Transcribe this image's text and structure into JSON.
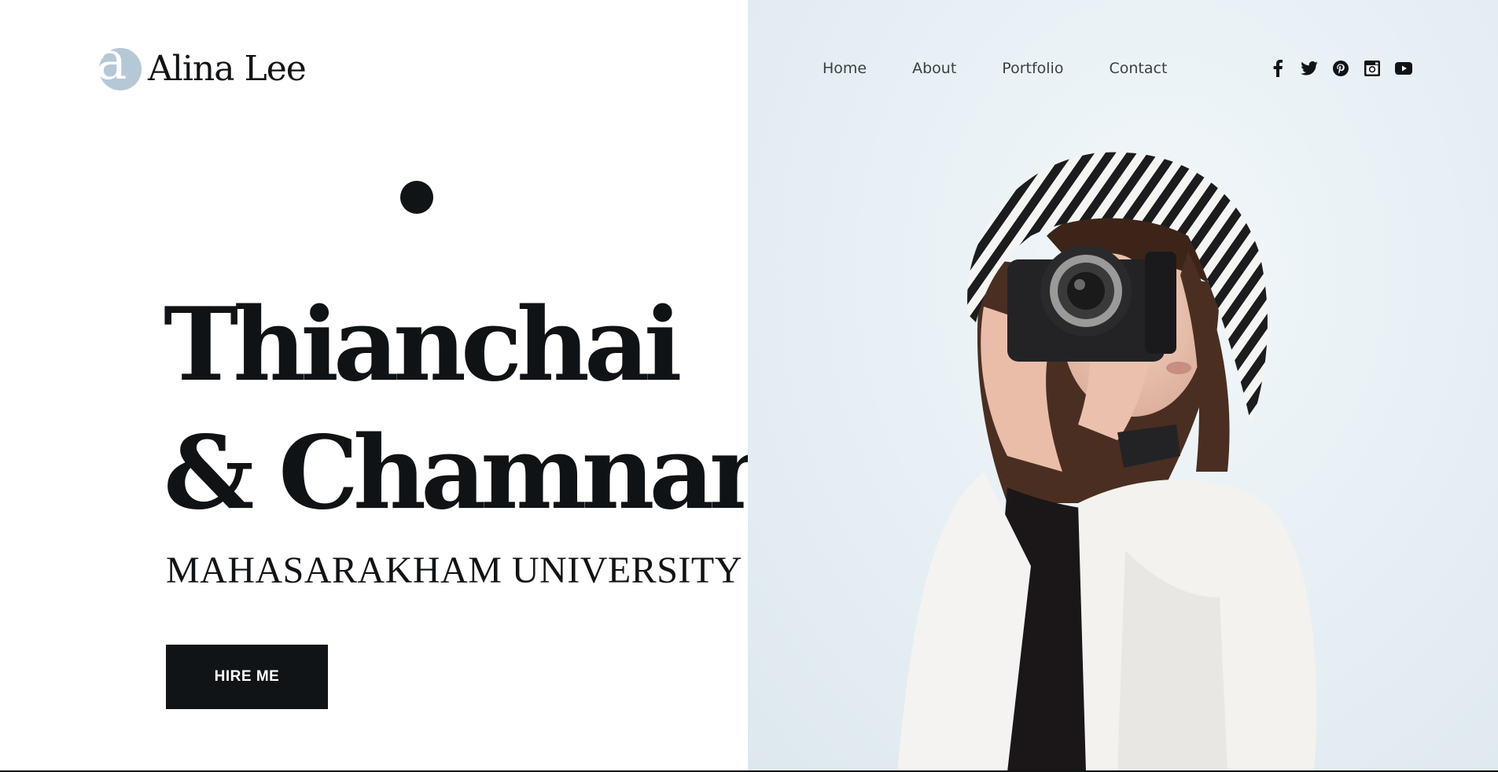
{
  "brand": {
    "logo_letter": "a",
    "name": "Alina Lee",
    "mark_color": "#b6c8d6"
  },
  "nav": {
    "items": [
      {
        "label": "Home"
      },
      {
        "label": "About"
      },
      {
        "label": "Portfolio"
      },
      {
        "label": "Contact"
      }
    ]
  },
  "socials": [
    {
      "icon": "facebook-icon"
    },
    {
      "icon": "twitter-icon"
    },
    {
      "icon": "pinterest-icon"
    },
    {
      "icon": "instagram-icon"
    },
    {
      "icon": "youtube-icon"
    }
  ],
  "hero": {
    "title_line1": "Thianchai",
    "title_line2": "& Chamnan",
    "subtitle": "MAHASARAKHAM UNIVERSITY",
    "cta_label": "HIRE ME"
  },
  "colors": {
    "text_dark": "#101315",
    "button_bg": "#111416",
    "photo_bg": "#e6eff4"
  }
}
